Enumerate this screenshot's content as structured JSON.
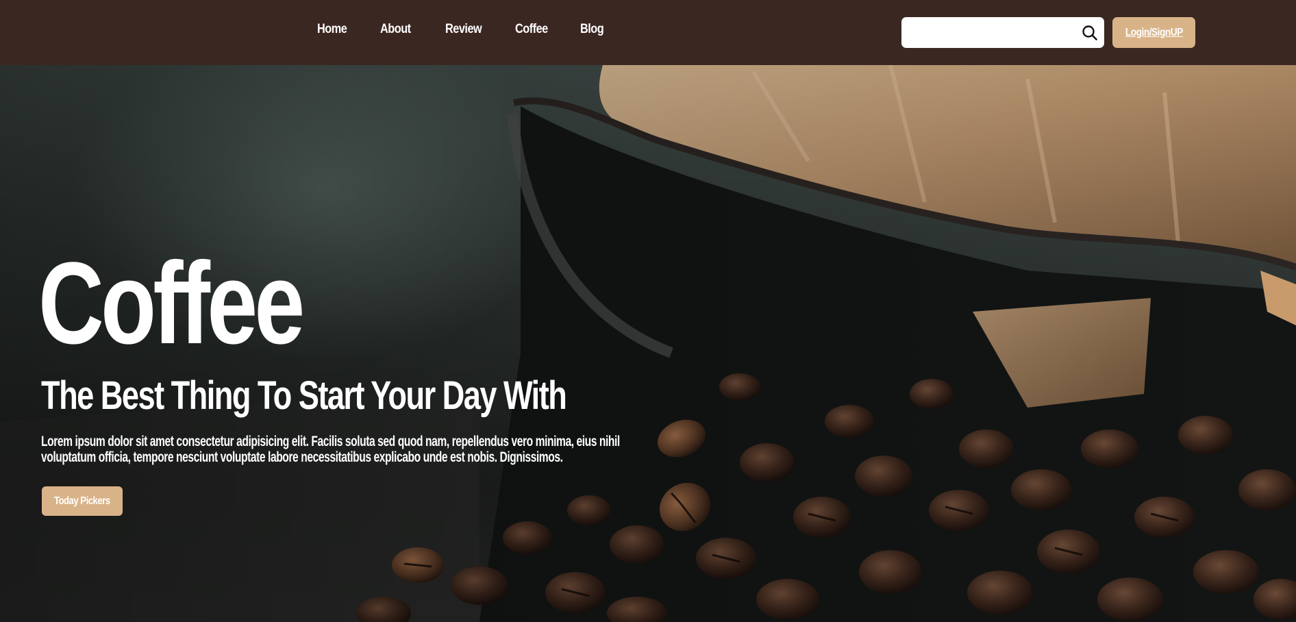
{
  "nav": {
    "links": [
      {
        "label": "Home"
      },
      {
        "label": "About"
      },
      {
        "label": "Review"
      },
      {
        "label": "Coffee"
      },
      {
        "label": "Blog"
      }
    ],
    "search": {
      "value": "",
      "placeholder": ""
    },
    "login_label": "Login/SignUP"
  },
  "hero": {
    "title": "Coffee",
    "subtitle": "The Best Thing To Start Your Day With",
    "text": "Lorem ipsum dolor sit amet consectetur adipisicing elit. Facilis soluta sed quod nam, repellendus vero minima, eius nihil voluptatum officia, tempore nesciunt voluptate labore necessitatibus explicabo unde est nobis. Dignissimos.",
    "button_label": "Today Pickers",
    "background_image": "coffee-beans-spilling-from-paper-bag"
  },
  "colors": {
    "navbar": "#3b2722",
    "accent": "#d9b388",
    "text": "#ffffff"
  }
}
